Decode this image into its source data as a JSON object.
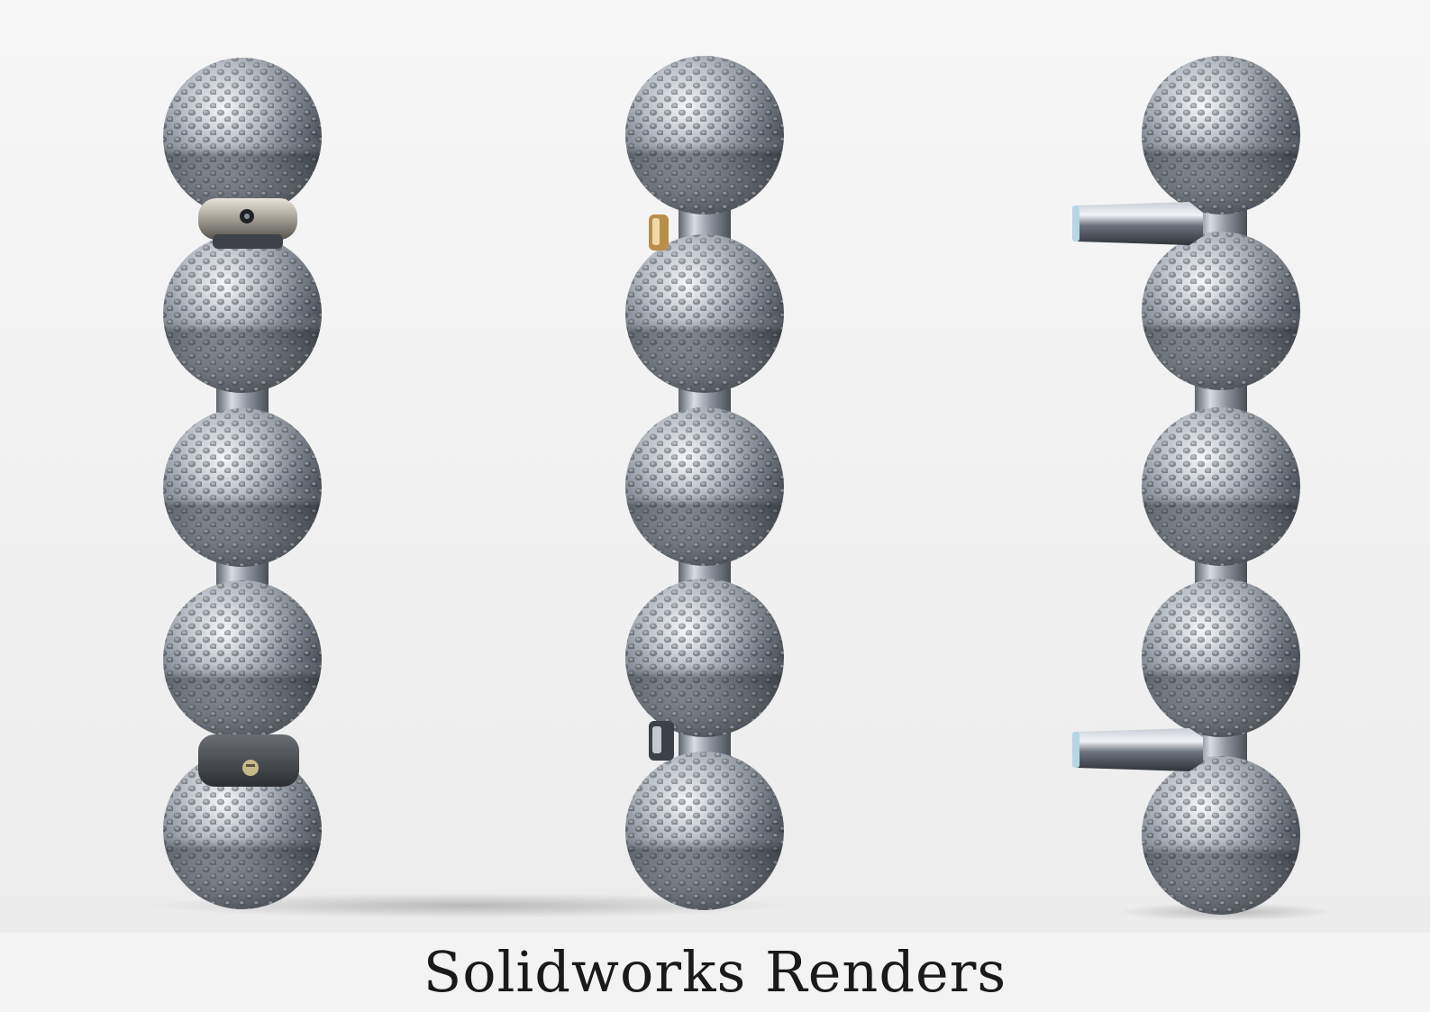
{
  "caption": "Solidworks Renders",
  "views": [
    {
      "id": "view-front",
      "balls": 5,
      "hardware": "clamp-rings"
    },
    {
      "id": "view-side",
      "balls": 5,
      "hardware": "edge-mounts"
    },
    {
      "id": "view-profile",
      "balls": 5,
      "hardware": "standoff-posts"
    }
  ],
  "colors": {
    "background": "#f2f2f2",
    "metal_light": "#e4e8ee",
    "metal_mid": "#8b929c",
    "metal_dark": "#3a3f46",
    "caption_text": "#1a1a1a"
  }
}
